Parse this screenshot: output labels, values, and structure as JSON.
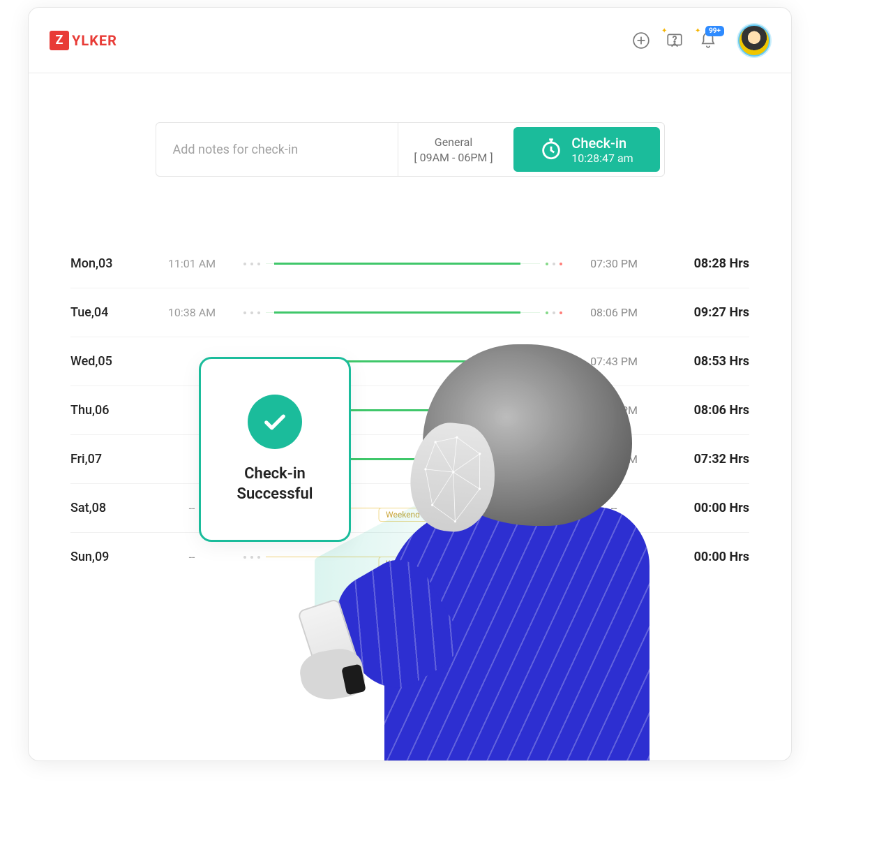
{
  "brand": {
    "badge": "Z",
    "text": "YLKER"
  },
  "header": {
    "notification_badge": "99+"
  },
  "checkin_bar": {
    "notes_placeholder": "Add notes for check-in",
    "shift_name": "General",
    "shift_hours": "[ 09AM - 06PM ]",
    "button_label": "Check-in",
    "button_time": "10:28:47 am"
  },
  "rows": [
    {
      "day": "Mon,03",
      "in": "11:01 AM",
      "out": "07:30 PM",
      "dur": "08:28 Hrs",
      "type": "work"
    },
    {
      "day": "Tue,04",
      "in": "10:38 AM",
      "out": "08:06 PM",
      "dur": "09:27 Hrs",
      "type": "work"
    },
    {
      "day": "Wed,05",
      "in": "",
      "out": "07:43 PM",
      "dur": "08:53 Hrs",
      "type": "work"
    },
    {
      "day": "Thu,06",
      "in": "",
      "out": "07:31 PM",
      "dur": "08:06 Hrs",
      "type": "work"
    },
    {
      "day": "Fri,07",
      "in": "",
      "out": "06:37 PM",
      "dur": "07:32 Hrs",
      "type": "work"
    },
    {
      "day": "Sat,08",
      "in": "--",
      "out": "--",
      "dur": "00:00 Hrs",
      "type": "weekend",
      "pill": "Weekend"
    },
    {
      "day": "Sun,09",
      "in": "--",
      "out": "--",
      "dur": "00:00 Hrs",
      "type": "weekend",
      "pill": "Weekend"
    }
  ],
  "popup": {
    "line1": "Check-in",
    "line2": "Successful"
  },
  "colors": {
    "accent": "#1BBC9B",
    "brand_red": "#E83B36",
    "blue": "#2d2fd1"
  }
}
